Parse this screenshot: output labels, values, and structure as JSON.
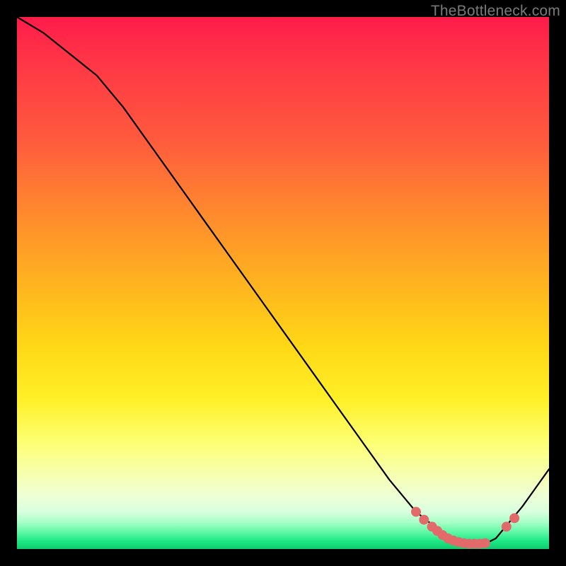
{
  "watermark": "TheBottleneck.com",
  "chart_data": {
    "type": "line",
    "title": "",
    "xlabel": "",
    "ylabel": "",
    "xlim": [
      0,
      100
    ],
    "ylim": [
      0,
      100
    ],
    "grid": false,
    "legend": false,
    "series": [
      {
        "name": "bottleneck-curve",
        "color": "#000000",
        "x": [
          0,
          5,
          10,
          15,
          20,
          25,
          30,
          35,
          40,
          45,
          50,
          55,
          60,
          65,
          70,
          75,
          80,
          82,
          85,
          88,
          90,
          95,
          100
        ],
        "y": [
          100,
          97,
          93,
          89,
          83,
          76,
          69,
          62,
          55,
          48,
          41,
          34,
          27,
          20,
          13,
          7,
          3,
          2,
          1,
          1,
          2,
          8,
          15
        ]
      },
      {
        "name": "highlight-dots-left",
        "type": "scatter",
        "color": "#e36a6a",
        "x": [
          75,
          76.5,
          78,
          79,
          80,
          81,
          82,
          83,
          84,
          85,
          86,
          87,
          88
        ],
        "y": [
          7,
          5.5,
          4.2,
          3.4,
          2.6,
          2.0,
          1.6,
          1.3,
          1.1,
          1.0,
          1.0,
          1.0,
          1.1
        ]
      },
      {
        "name": "highlight-dots-right",
        "type": "scatter",
        "color": "#e36a6a",
        "x": [
          92,
          93.5
        ],
        "y": [
          4.2,
          5.8
        ]
      }
    ]
  }
}
